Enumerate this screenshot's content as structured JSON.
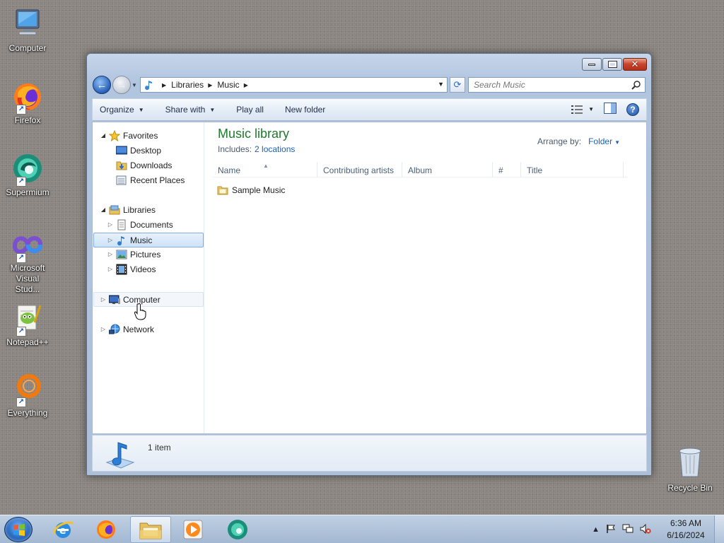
{
  "desktop": {
    "icons": [
      {
        "label": "Computer",
        "icon": "computer-icon"
      },
      {
        "label": "Firefox",
        "icon": "firefox-icon"
      },
      {
        "label": "Supermium",
        "icon": "supermium-icon"
      },
      {
        "label": "Microsoft Visual Stud...",
        "icon": "visual-studio-icon"
      },
      {
        "label": "Notepad++",
        "icon": "notepadpp-icon"
      },
      {
        "label": "Everything",
        "icon": "everything-icon"
      }
    ],
    "recycle_bin": {
      "label": "Recycle Bin",
      "icon": "recycle-bin-icon"
    }
  },
  "window": {
    "address": {
      "crumbs": [
        "Libraries",
        "Music"
      ]
    },
    "search": {
      "placeholder": "Search Music"
    },
    "commandbar": {
      "organize": "Organize",
      "share_with": "Share with",
      "play_all": "Play all",
      "new_folder": "New folder"
    },
    "nav": {
      "favorites": "Favorites",
      "desktop": "Desktop",
      "downloads": "Downloads",
      "recent_places": "Recent Places",
      "libraries": "Libraries",
      "documents": "Documents",
      "music": "Music",
      "pictures": "Pictures",
      "videos": "Videos",
      "computer": "Computer",
      "network": "Network"
    },
    "library": {
      "title": "Music library",
      "includes_label": "Includes:",
      "locations_link": "2 locations",
      "arrange_label": "Arrange by:",
      "arrange_value": "Folder"
    },
    "columns": [
      "Name",
      "Contributing artists",
      "Album",
      "#",
      "Title"
    ],
    "files": [
      {
        "name": "Sample Music",
        "type": "folder"
      }
    ],
    "details": {
      "count": "1 item"
    }
  },
  "taskbar": {
    "apps": [
      "start-orb",
      "internet-explorer",
      "firefox",
      "explorer",
      "media-player",
      "supermium"
    ],
    "clock": {
      "time": "6:36 AM",
      "date": "6/16/2024"
    }
  },
  "colors": {
    "library_title": "#1e7b2d",
    "link": "#2061b5",
    "selection": "#cde3f8"
  }
}
